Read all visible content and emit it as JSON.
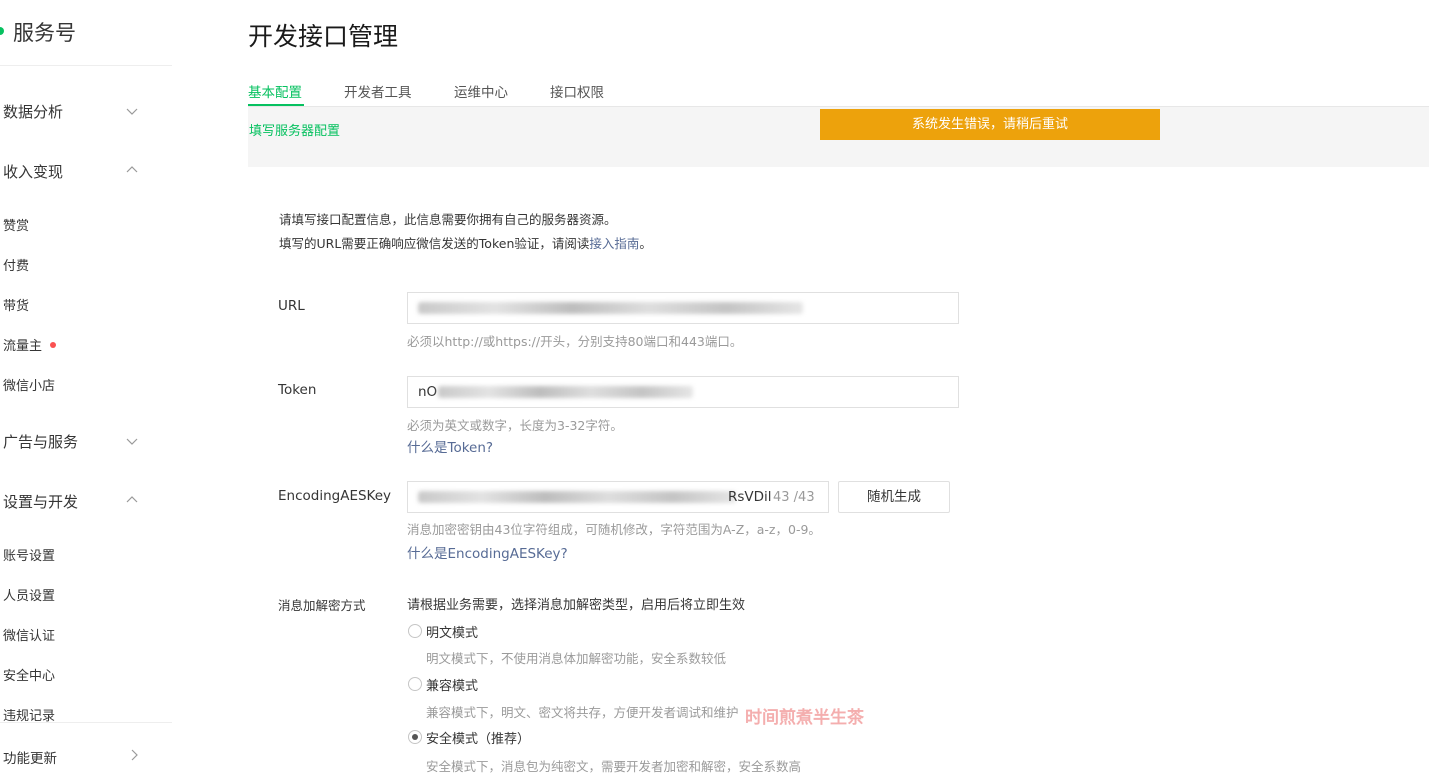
{
  "sidebar": {
    "brand": "服务号",
    "groups": {
      "data_analysis": "数据分析",
      "monetization": "收入变现",
      "ads_services": "广告与服务",
      "settings_dev": "设置与开发",
      "feature_updates": "功能更新"
    },
    "monetization_items": [
      "赞赏",
      "付费",
      "带货",
      "流量主",
      "微信小店"
    ],
    "settings_items": [
      "账号设置",
      "人员设置",
      "微信认证",
      "安全中心",
      "违规记录"
    ]
  },
  "header": {
    "title": "开发接口管理",
    "tabs": [
      "基本配置",
      "开发者工具",
      "运维中心",
      "接口权限"
    ],
    "active_tab": "基本配置",
    "breadcrumb": "填写服务器配置"
  },
  "toast": {
    "text": "系统发生错误，请稍后重试",
    "color": "#eda20c"
  },
  "form": {
    "intro_line1": "请填写接口配置信息，此信息需要你拥有自己的服务器资源。",
    "intro_line2_prefix": "填写的URL需要正确响应微信发送的Token验证，请阅读",
    "intro_link": "接入指南",
    "intro_line2_suffix": "。",
    "url": {
      "label": "URL",
      "hint": "必须以http://或https://开头，分别支持80端口和443端口。"
    },
    "token": {
      "label": "Token",
      "value_visible": "nO",
      "hint": "必须为英文或数字，长度为3-32字符。",
      "help_link": "什么是Token?"
    },
    "aes": {
      "label": "EncodingAESKey",
      "value_visible": "RsVDil",
      "counter": "43 /43",
      "generate_button": "随机生成",
      "hint": "消息加密密钥由43位字符组成，可随机修改，字符范围为A-Z，a-z，0-9。",
      "help_link": "什么是EncodingAESKey?"
    },
    "encryption": {
      "label": "消息加解密方式",
      "hint": "请根据业务需要，选择消息加解密类型，启用后将立即生效",
      "options": [
        {
          "label": "明文模式",
          "desc": "明文模式下，不使用消息体加解密功能，安全系数较低",
          "checked": false
        },
        {
          "label": "兼容模式",
          "desc": "兼容模式下，明文、密文将共存，方便开发者调试和维护",
          "checked": false
        },
        {
          "label": "安全模式（推荐）",
          "desc": "安全模式下，消息包为纯密文，需要开发者加密和解密，安全系数高",
          "checked": true
        }
      ]
    }
  },
  "watermark": "时间煎煮半生茶",
  "colors": {
    "accent": "#07c160",
    "link": "#576b95",
    "alert_dot": "#fa5151"
  }
}
